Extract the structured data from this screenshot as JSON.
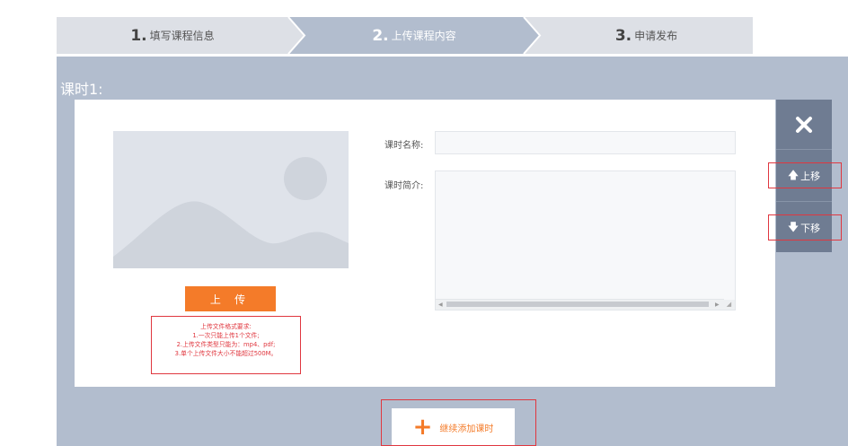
{
  "stepper": {
    "steps": [
      {
        "num": "1.",
        "label": "填写课程信息"
      },
      {
        "num": "2.",
        "label": "上传课程内容"
      },
      {
        "num": "3.",
        "label": "申请发布"
      }
    ],
    "active_index": 1,
    "colors": {
      "inactive": "#dde0e6",
      "active": "#b2bdce"
    }
  },
  "lesson": {
    "title": "课时1:",
    "upload_button": "上 传",
    "requirements": {
      "heading": "上传文件格式要求:",
      "lines": [
        "1.一次只能上传1个文件;",
        "2.上传文件类型只能为：mp4、pdf;",
        "3.单个上传文件大小不能超过500M。"
      ]
    },
    "name_label": "课时名称:",
    "name_value": "",
    "desc_label": "课时简介:",
    "desc_value": ""
  },
  "controls": {
    "close_icon": "close-x-icon",
    "move_up": "上移",
    "move_down": "下移"
  },
  "add_lesson": {
    "label": "继续添加课时",
    "icon": "plus-icon"
  },
  "colors": {
    "accent": "#f47b29",
    "panel_bg": "#b2bdce",
    "side_ctrl": "#6f7c92",
    "highlight": "#e0373f"
  }
}
